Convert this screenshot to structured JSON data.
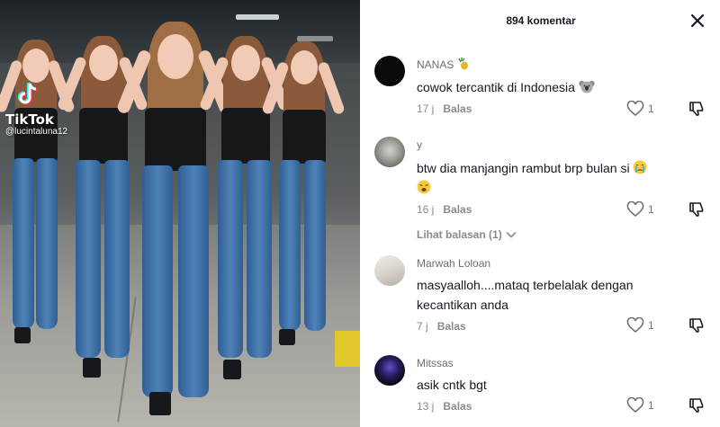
{
  "video": {
    "brand": "TikTok",
    "username": "@lucintaluna12"
  },
  "comments_panel": {
    "title": "894 komentar",
    "comments": [
      {
        "user": "NANAS",
        "user_emoji": "pineapple-icon",
        "text": "cowok tercantik di Indonesia",
        "text_emoji": "koala-icon",
        "time": "17 j",
        "reply_label": "Balas",
        "likes": "1"
      },
      {
        "user": "y",
        "text": "btw dia manjangin rambut brp bulan si",
        "text_emojis": [
          "crying-face-icon",
          "weary-face-icon"
        ],
        "time": "16 j",
        "reply_label": "Balas",
        "likes": "1",
        "view_replies": "Lihat balasan (1)"
      },
      {
        "user": "Marwah Loloan",
        "text": "masyaalloh....mataq terbelalak dengan kecantikan anda",
        "time": "7 j",
        "reply_label": "Balas",
        "likes": "1"
      },
      {
        "user": "Mitssas",
        "text": "asik cntk bgt",
        "time": "13 j",
        "reply_label": "Balas",
        "likes": "1"
      }
    ]
  },
  "colors": {
    "jeans": "#3f6f9f",
    "top": "#16171a",
    "floor_mark": "#e2c72b",
    "muted_text": "#8a8b91"
  }
}
